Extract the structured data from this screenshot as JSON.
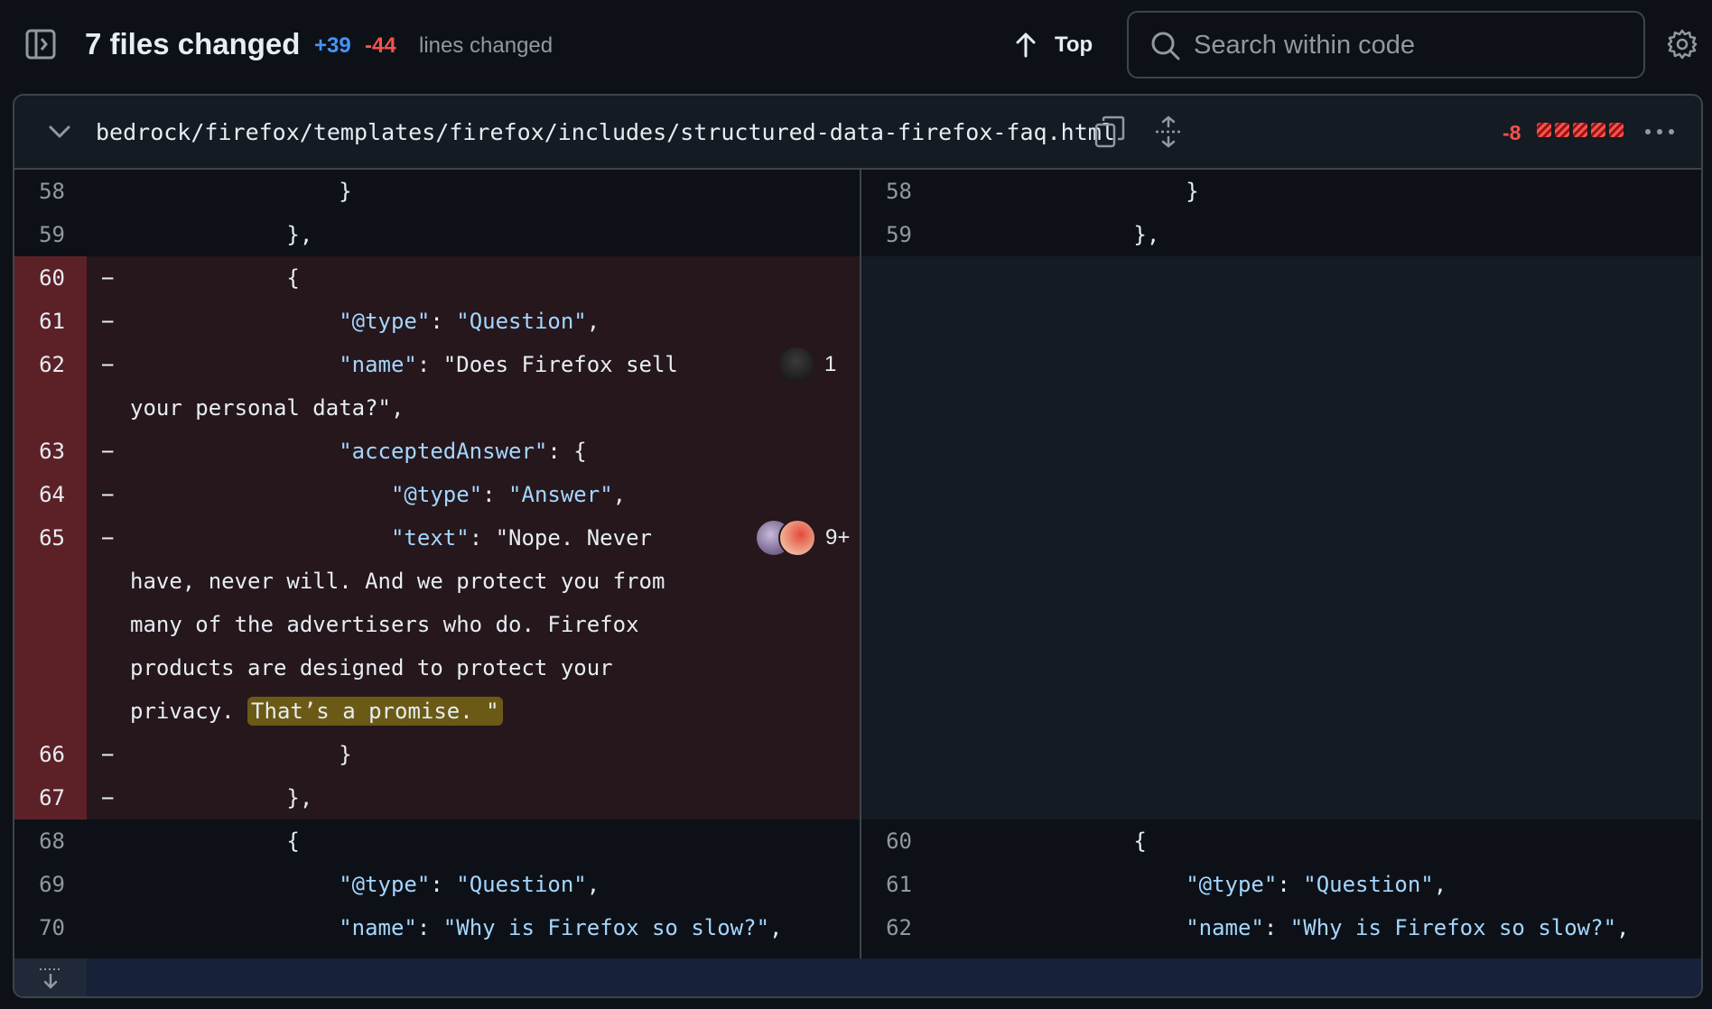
{
  "header": {
    "title": "7 files changed",
    "additions": "+39",
    "deletions": "-44",
    "lines_label": "lines changed",
    "top_label": "Top",
    "search_placeholder": "Search within code"
  },
  "file": {
    "path": "bedrock/firefox/templates/firefox/includes/structured-data-firefox-faq.html",
    "deletions": "-8",
    "deletion_blocks": 5
  },
  "left": [
    {
      "n": "58",
      "t": "                }"
    },
    {
      "n": "59",
      "t": "            },"
    },
    {
      "n": "60",
      "m": "−",
      "t": "            {"
    },
    {
      "n": "61",
      "m": "−",
      "t": "                \"@type\": \"Question\","
    },
    {
      "n": "62",
      "m": "−",
      "t": "                \"name\": \"Does Firefox sell"
    },
    {
      "n": "",
      "t": "your personal data?\","
    },
    {
      "n": "63",
      "m": "−",
      "t": "                \"acceptedAnswer\": {"
    },
    {
      "n": "64",
      "m": "−",
      "t": "                    \"@type\": \"Answer\","
    },
    {
      "n": "65",
      "m": "−",
      "t": "                    \"text\": \"Nope. Never"
    },
    {
      "n": "",
      "t": "have, never will. And we protect you from"
    },
    {
      "n": "",
      "t": "many of the advertisers who do. Firefox"
    },
    {
      "n": "",
      "t": "products are designed to protect your"
    },
    {
      "n": "",
      "t": "privacy. ",
      "hl": "That’s a promise. \""
    },
    {
      "n": "66",
      "m": "−",
      "t": "                }"
    },
    {
      "n": "67",
      "m": "−",
      "t": "            },"
    },
    {
      "n": "68",
      "t": "            {"
    },
    {
      "n": "69",
      "t": "                \"@type\": \"Question\","
    },
    {
      "n": "70",
      "t": "                \"name\": \"Why is Firefox so slow?\","
    }
  ],
  "right": [
    {
      "n": "58",
      "t": "                }"
    },
    {
      "n": "59",
      "t": "            },"
    },
    {
      "n": "60",
      "t": "            {"
    },
    {
      "n": "61",
      "t": "                \"@type\": \"Question\","
    },
    {
      "n": "62",
      "t": "                \"name\": \"Why is Firefox so slow?\","
    }
  ],
  "comments": [
    {
      "line": "62",
      "count": "1"
    },
    {
      "line": "65",
      "count": "9+"
    }
  ],
  "colors": {
    "background": "#0d1117",
    "addition": "#4493f8",
    "deletion": "#f85149",
    "deleted_row": "#25171c",
    "deleted_gutter": "#5c2127",
    "highlight": "#6b5a15"
  }
}
